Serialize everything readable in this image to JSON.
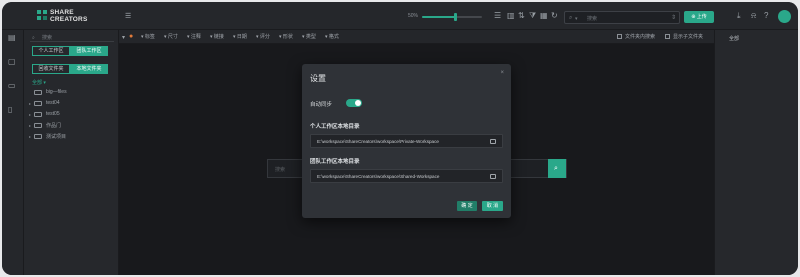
{
  "app": {
    "logo_line1": "SHARE",
    "logo_line2": "CREATORS",
    "brand_color": "#2aa88a"
  },
  "toolbar": {
    "zoom": "50%",
    "zoom_fraction": 0.55,
    "search_placeholder": "搜索",
    "upload_label": "上传"
  },
  "sidebar": {
    "search_placeholder": "搜索",
    "workspace_tabs": [
      "个人工作区",
      "团队工作区"
    ],
    "view_tabs": [
      "回收文件夹",
      "本地文件夹"
    ],
    "all_label": "全部 ▾",
    "tree": [
      {
        "label": "big—files",
        "expandable": false
      },
      {
        "label": "test04",
        "expandable": true
      },
      {
        "label": "test05",
        "expandable": true
      },
      {
        "label": "作品门",
        "expandable": true
      },
      {
        "label": "测试项目",
        "expandable": true
      }
    ]
  },
  "filters": {
    "items": [
      "标签",
      "尺寸",
      "注释",
      "链接",
      "日期",
      "评分",
      "形状",
      "类型",
      "格式"
    ],
    "folder_search": "文件夹内搜索",
    "subfolder": "显示子文件夹"
  },
  "right_panel": {
    "title": "全部"
  },
  "main": {
    "search_placeholder": "搜索"
  },
  "modal": {
    "title": "设置",
    "close": "×",
    "auto_sync_label": "自动同步",
    "auto_sync_on": true,
    "personal_label": "个人工作区本地目录",
    "personal_path": "E:\\workspace\\ShareCreators\\workspace\\Private-Workspace",
    "team_label": "团队工作区本地目录",
    "team_path": "E:\\workspace\\ShareCreators\\workspace\\Shared-Workspace",
    "ok_label": "确 定",
    "cancel_label": "取 消"
  }
}
